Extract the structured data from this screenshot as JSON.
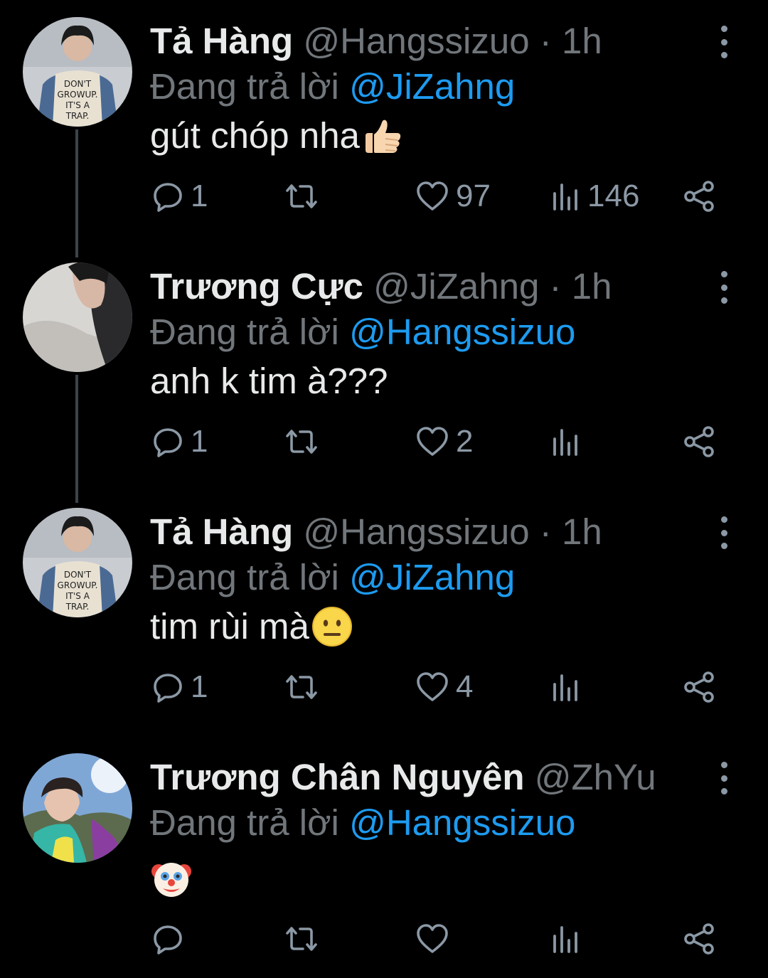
{
  "colors": {
    "background": "#000000",
    "name": "#e7e9ea",
    "secondary_text": "#71767b",
    "mention": "#1d9bf0",
    "icon": "#8b98a5",
    "thread_line": "#3a444c"
  },
  "tweets": [
    {
      "name": "Tả Hàng",
      "handle": "@Hangssizuo",
      "time": "1h",
      "reply_prefix": "Đang trả lời",
      "reply_to": "@JiZahng",
      "text": "gút chóp nha",
      "emoji": "thumbs-up",
      "replies": "1",
      "retweets": "",
      "likes": "97",
      "views": "146"
    },
    {
      "name": "Trương Cực",
      "handle": "@JiZahng",
      "time": "1h",
      "reply_prefix": "Đang trả lời",
      "reply_to": "@Hangssizuo",
      "text": "anh k tim à???",
      "emoji": "",
      "replies": "1",
      "retweets": "",
      "likes": "2",
      "views": ""
    },
    {
      "name": "Tả Hàng",
      "handle": "@Hangssizuo",
      "time": "1h",
      "reply_prefix": "Đang trả lời",
      "reply_to": "@JiZahng",
      "text": "tim rùi mà",
      "emoji": "neutral-face",
      "replies": "1",
      "retweets": "",
      "likes": "4",
      "views": ""
    },
    {
      "name": "Trương Chân Nguyên",
      "handle": "@ZhYua...",
      "time": "",
      "reply_prefix": "Đang trả lời",
      "reply_to": "@Hangssizuo",
      "text": "",
      "emoji": "clown-face",
      "replies": "",
      "retweets": "",
      "likes": "",
      "views": ""
    }
  ]
}
